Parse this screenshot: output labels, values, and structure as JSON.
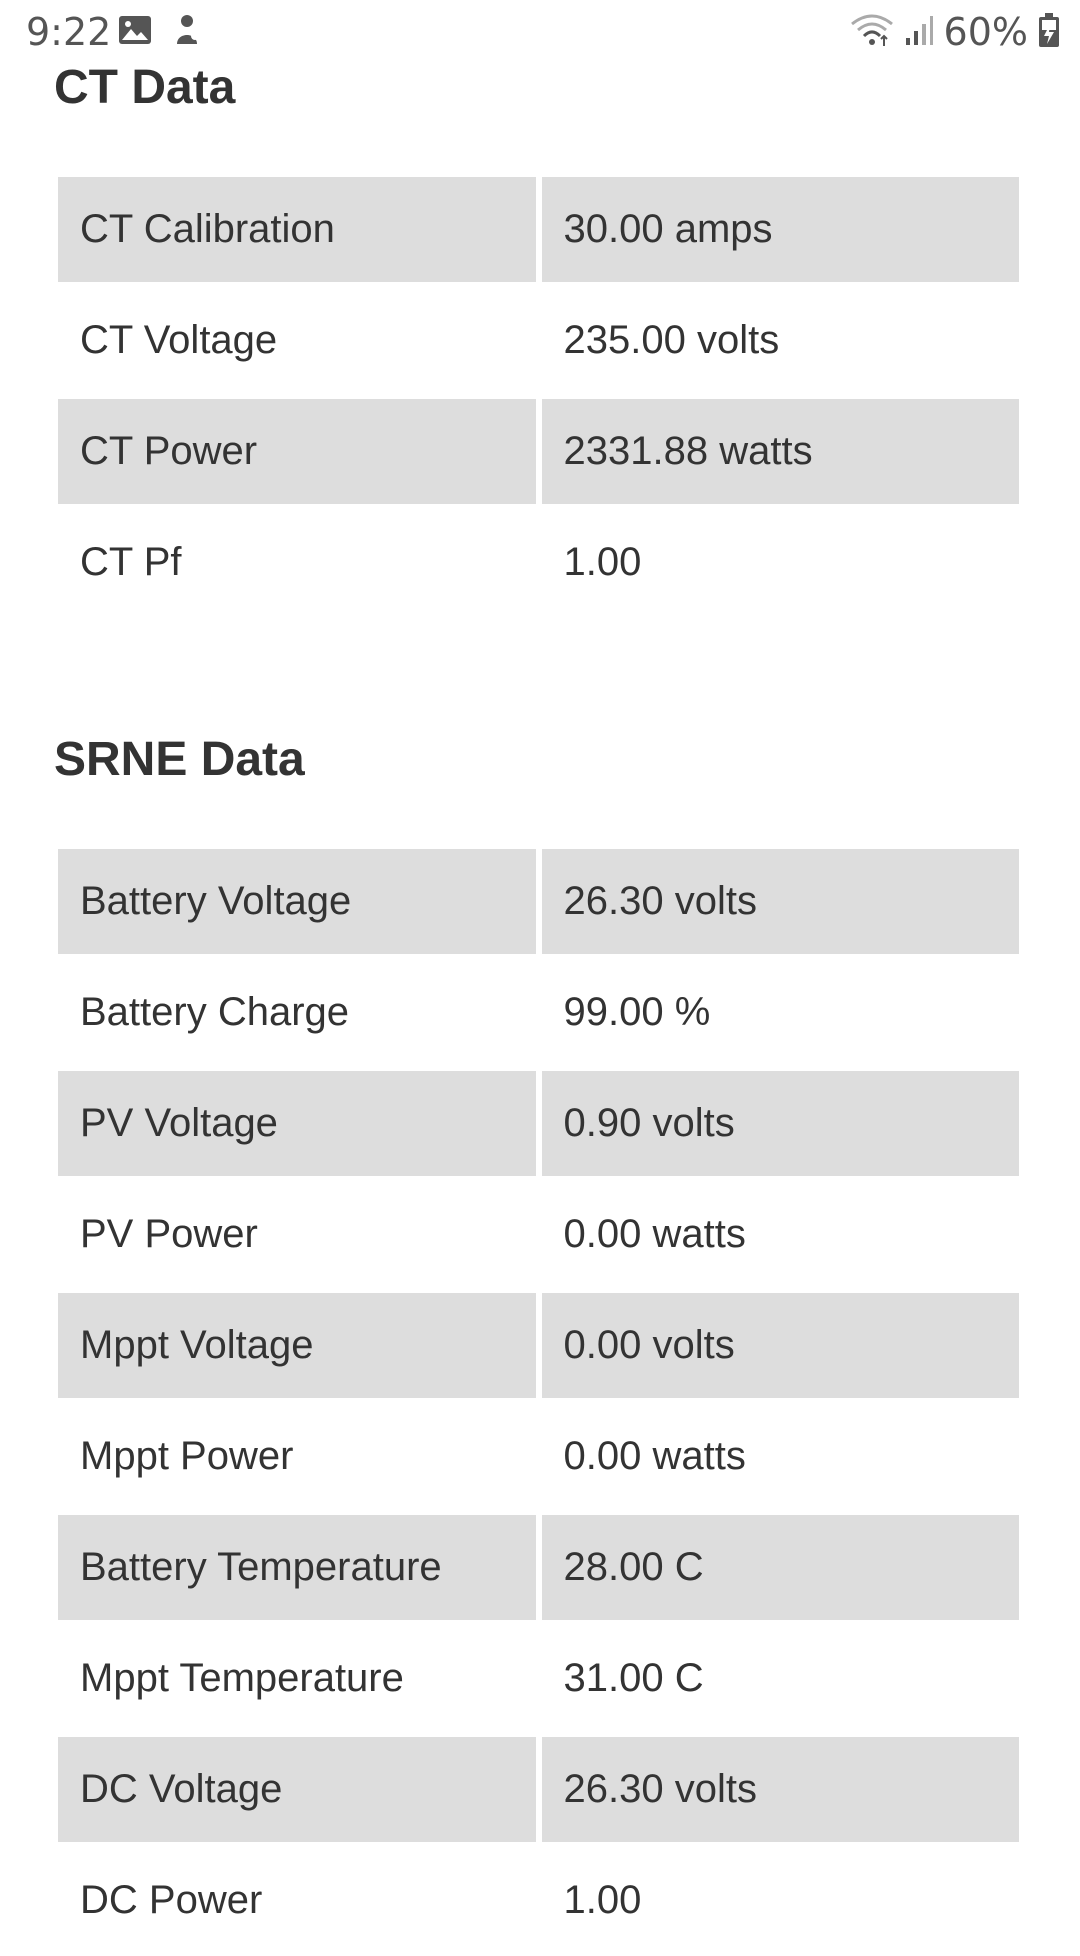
{
  "status_bar": {
    "time": "9:22",
    "battery_percent": "60%",
    "icons": [
      "image-icon",
      "notification-icon",
      "wifi-icon",
      "signal-icon",
      "battery-charging-icon"
    ]
  },
  "ct_section": {
    "title": "CT Data",
    "rows": [
      {
        "label": "CT Calibration",
        "value": "30.00 amps"
      },
      {
        "label": "CT Voltage",
        "value": "235.00 volts"
      },
      {
        "label": "CT Power",
        "value": "2331.88 watts"
      },
      {
        "label": "CT Pf",
        "value": "1.00"
      }
    ]
  },
  "srne_section": {
    "title": "SRNE Data",
    "rows": [
      {
        "label": "Battery Voltage",
        "value": "26.30 volts"
      },
      {
        "label": "Battery Charge",
        "value": "99.00 %"
      },
      {
        "label": "PV Voltage",
        "value": "0.90 volts"
      },
      {
        "label": "PV Power",
        "value": "0.00 watts"
      },
      {
        "label": "Mppt Voltage",
        "value": "0.00 volts"
      },
      {
        "label": "Mppt Power",
        "value": "0.00 watts"
      },
      {
        "label": "Battery Temperature",
        "value": "28.00 C"
      },
      {
        "label": "Mppt Temperature",
        "value": "31.00 C"
      },
      {
        "label": "DC Voltage",
        "value": "26.30 volts"
      },
      {
        "label": "DC Power",
        "value": "1.00"
      }
    ]
  },
  "colors": {
    "row_shade": "#dddddd",
    "text": "#333333",
    "background": "#ffffff"
  }
}
